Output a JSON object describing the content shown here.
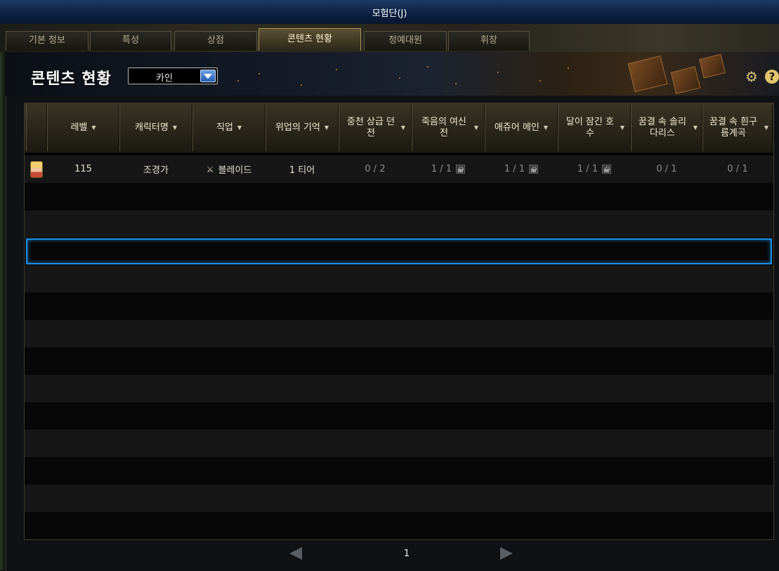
{
  "window": {
    "title": "모험단(J)"
  },
  "tabs": [
    {
      "label": "기본 정보",
      "active": false
    },
    {
      "label": "특성",
      "active": false
    },
    {
      "label": "상점",
      "active": false
    },
    {
      "label": "콘텐츠 현황",
      "active": true
    },
    {
      "label": "정예대원",
      "active": false
    },
    {
      "label": "휘장",
      "active": false
    }
  ],
  "header": {
    "title": "콘텐츠 현황",
    "server_select": "카인",
    "settings_icon": "gear-icon",
    "help_icon": "help-icon",
    "help_glyph": "?"
  },
  "table": {
    "columns": [
      {
        "label": ""
      },
      {
        "label": "레벨",
        "sortable": true
      },
      {
        "label": "캐릭터명",
        "sortable": true
      },
      {
        "label": "직업",
        "sortable": true
      },
      {
        "label": "위업의 기억",
        "sortable": true
      },
      {
        "label": "중천 상급 던전",
        "sortable": true
      },
      {
        "label": "죽음의 여신전",
        "sortable": true
      },
      {
        "label": "애쥬어 메인",
        "sortable": true
      },
      {
        "label": "달이 잠긴 호수",
        "sortable": true
      },
      {
        "label": "꿈결 속 솔리다리스",
        "sortable": true
      },
      {
        "label": "꿈결 속 흰구름계곡",
        "sortable": true
      }
    ],
    "rows": [
      {
        "level": "115",
        "name": "조경가",
        "job": "블레이드",
        "job_icon": "blade-class-icon",
        "memory": "1 티어",
        "c5": "0 / 2",
        "c6": "1 / 1",
        "c7": "1 / 1",
        "c8": "1 / 1",
        "c9": "0 / 1",
        "c10": "0 / 1"
      }
    ],
    "empty_row_count": 13,
    "selected_row_index": 3
  },
  "pagination": {
    "current_page": "1"
  },
  "colors": {
    "title_bar": "#0d2143",
    "selection": "#1d8fe0",
    "tab_active": "#5b5033",
    "dropdown_button": "#285fb8"
  }
}
